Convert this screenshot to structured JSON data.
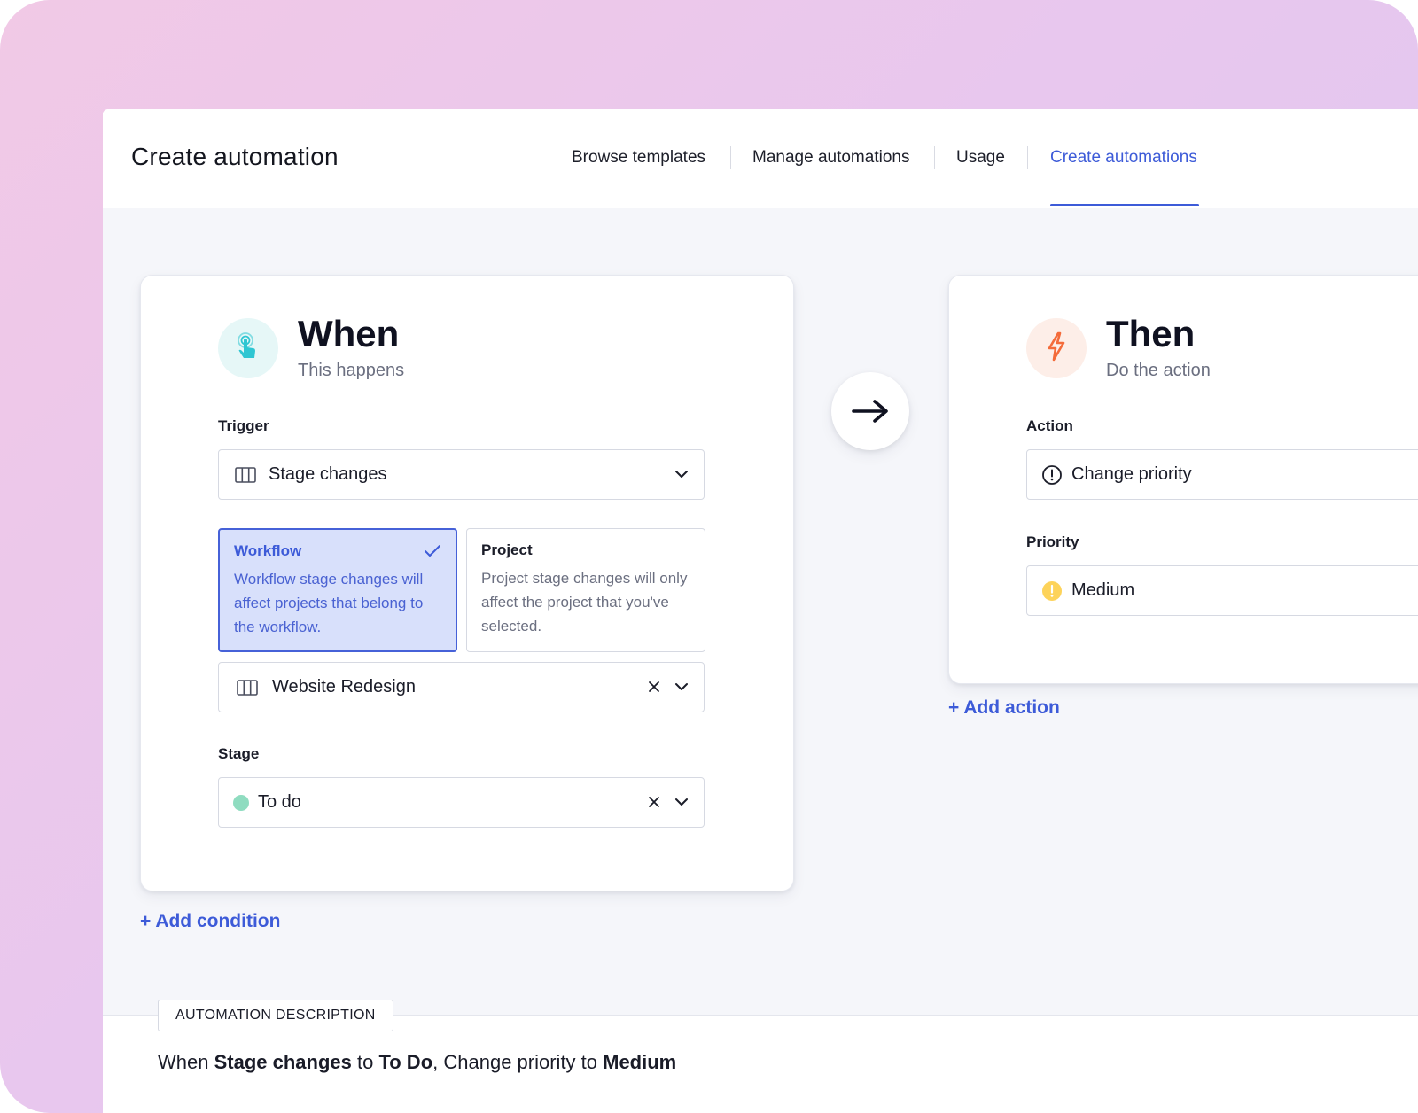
{
  "header": {
    "title": "Create automation",
    "nav": [
      {
        "label": "Browse templates",
        "active": false
      },
      {
        "label": "Manage automations",
        "active": false
      },
      {
        "label": "Usage",
        "active": false
      },
      {
        "label": "Create automations",
        "active": true
      }
    ]
  },
  "when": {
    "icon": "touch-pointer-icon",
    "heading": "When",
    "subheading": "This happens",
    "trigger_label": "Trigger",
    "trigger_value": "Stage changes",
    "options": [
      {
        "title": "Workflow",
        "description": "Workflow stage changes will affect projects that belong to the workflow.",
        "selected": true
      },
      {
        "title": "Project",
        "description": "Project stage changes will only affect the project that you've selected.",
        "selected": false
      }
    ],
    "workflow_value": "Website Redesign",
    "stage_label": "Stage",
    "stage_value": "To do",
    "stage_color": "#8fdcc0",
    "add_condition": "+ Add condition"
  },
  "then": {
    "icon": "lightning-icon",
    "heading": "Then",
    "subheading": "Do the action",
    "action_label": "Action",
    "action_value": "Change priority",
    "priority_label": "Priority",
    "priority_value": "Medium",
    "priority_color": "#fdd35a",
    "add_action": "+ Add action"
  },
  "description": {
    "tag": "AUTOMATION DESCRIPTION",
    "parts": {
      "p1": "When ",
      "p2": "Stage changes",
      "p3": " to ",
      "p4": "To Do",
      "p5": ", Change priority to ",
      "p6": "Medium"
    }
  },
  "colors": {
    "accent": "#3d5bd8",
    "when_badge_bg": "#e6f7f7",
    "then_badge_bg": "#fdeee8",
    "when_icon": "#2fc6d2",
    "then_icon": "#f46b3a"
  }
}
